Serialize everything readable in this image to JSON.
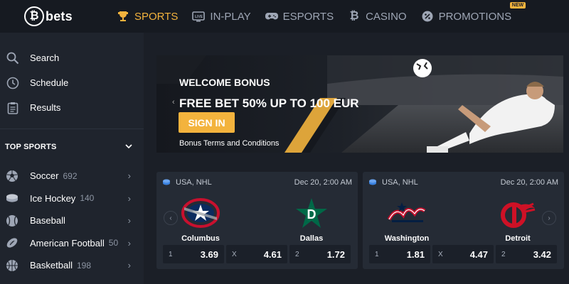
{
  "brand": {
    "logo_glyph": "₿",
    "logo_text": "bets",
    "accent": "#f3b33d"
  },
  "nav": {
    "items": [
      {
        "label": "SPORTS",
        "icon": "trophy-icon",
        "active": true
      },
      {
        "label": "IN-PLAY",
        "icon": "live-tv-icon"
      },
      {
        "label": "ESPORTS",
        "icon": "gamepad-icon"
      },
      {
        "label": "CASINO",
        "icon": "bitcoin-icon"
      },
      {
        "label": "PROMOTIONS",
        "icon": "promo-icon",
        "badge": "NEW"
      }
    ]
  },
  "sidebar": {
    "links": [
      {
        "label": "Search",
        "icon": "search-icon"
      },
      {
        "label": "Schedule",
        "icon": "clock-icon"
      },
      {
        "label": "Results",
        "icon": "clipboard-icon"
      }
    ],
    "section_title": "TOP SPORTS",
    "sports": [
      {
        "label": "Soccer",
        "count": "692",
        "icon": "soccer-ball-icon"
      },
      {
        "label": "Ice Hockey",
        "count": "140",
        "icon": "hockey-puck-icon"
      },
      {
        "label": "Baseball",
        "count": "",
        "icon": "baseball-icon"
      },
      {
        "label": "American Football",
        "count": "50",
        "icon": "american-football-icon"
      },
      {
        "label": "Basketball",
        "count": "198",
        "icon": "basketball-icon"
      }
    ]
  },
  "banner": {
    "title": "WELCOME BONUS",
    "headline": "FREE BET 50% UP TO 100 EUR",
    "cta": "SIGN IN",
    "terms": "Bonus Terms and Conditions"
  },
  "matches": [
    {
      "league": "USA, NHL",
      "date": "Dec 20, 2:00 AM",
      "home": "Columbus",
      "away": "Dallas",
      "odds": [
        {
          "label": "1",
          "value": "3.69"
        },
        {
          "label": "X",
          "value": "4.61"
        },
        {
          "label": "2",
          "value": "1.72"
        }
      ]
    },
    {
      "league": "USA, NHL",
      "date": "Dec 20, 2:00 AM",
      "home": "Washington",
      "away": "Detroit",
      "odds": [
        {
          "label": "1",
          "value": "1.81"
        },
        {
          "label": "X",
          "value": "4.47"
        },
        {
          "label": "2",
          "value": "3.42"
        }
      ]
    }
  ]
}
